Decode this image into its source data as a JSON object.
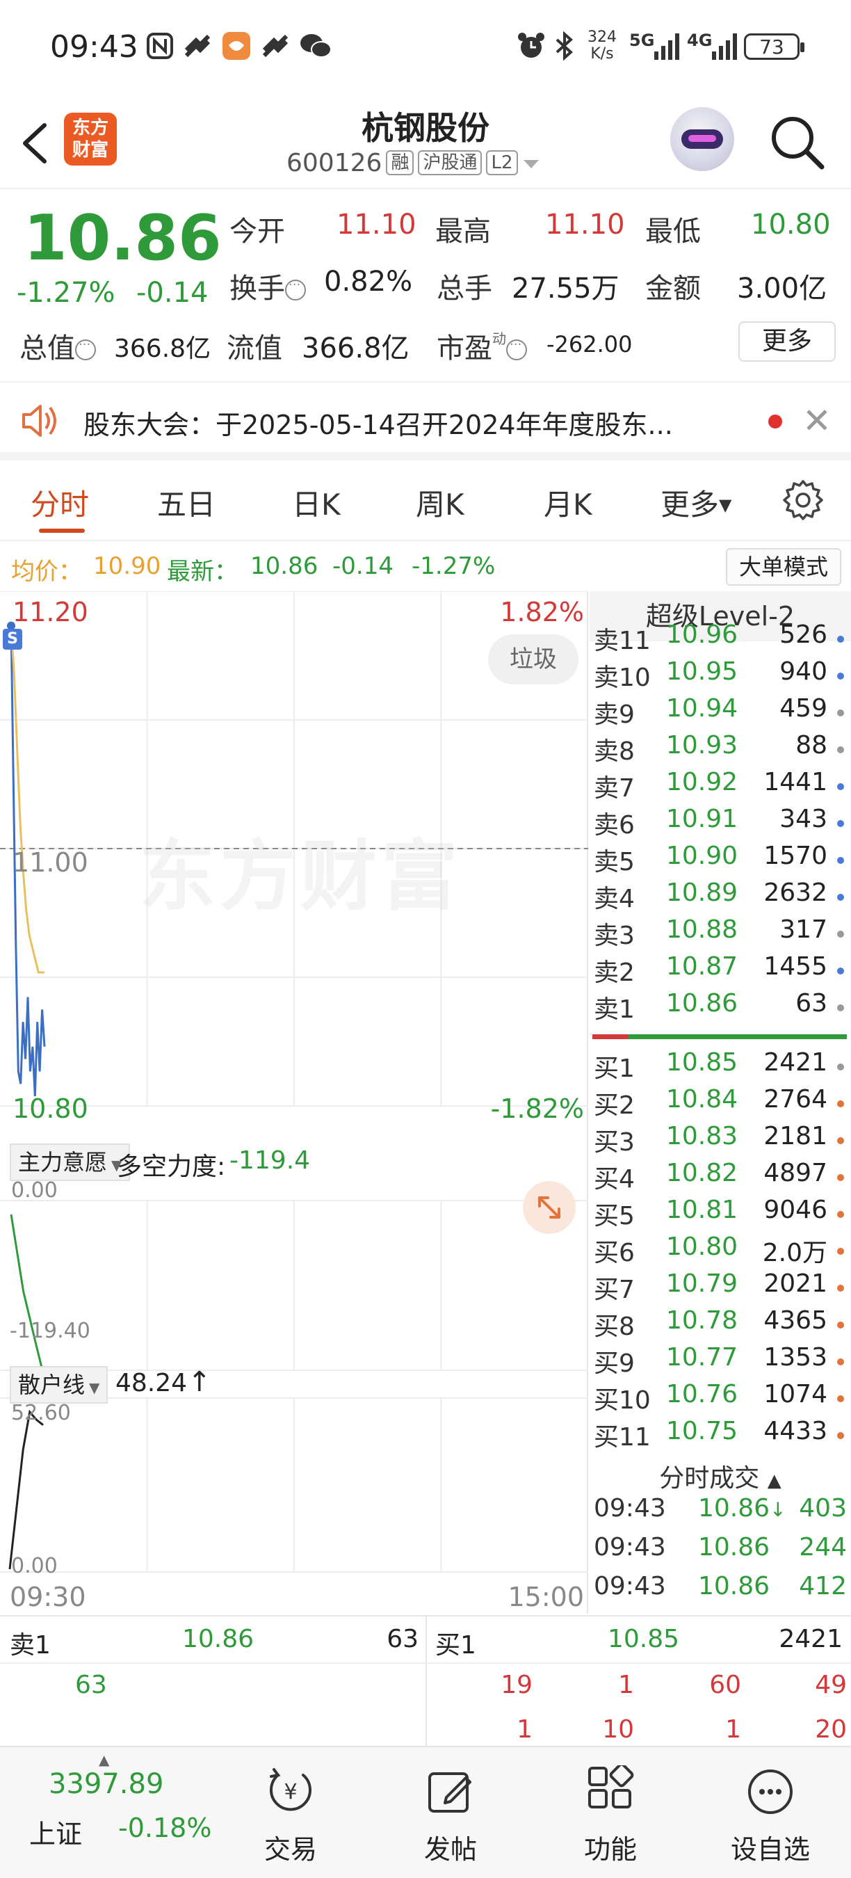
{
  "status_bar": {
    "time": "09:43",
    "net_speed_value": "324",
    "net_speed_unit": "K/s",
    "signal_5g": "5G",
    "signal_4g": "4G",
    "battery": "73"
  },
  "header": {
    "app_logo_line1": "东方",
    "app_logo_line2": "财富",
    "stock_name": "杭钢股份",
    "stock_code": "600126",
    "tags": [
      "融",
      "沪股通",
      "L2"
    ]
  },
  "quote": {
    "price": "10.86",
    "change_pct": "-1.27%",
    "change_amt": "-0.14",
    "open_label": "今开",
    "open": "11.10",
    "high_label": "最高",
    "high": "11.10",
    "low_label": "最低",
    "low": "10.80",
    "turnover_label": "换手",
    "turnover": "0.82%",
    "volume_label": "总手",
    "volume": "27.55万",
    "amount_label": "金额",
    "amount": "3.00亿",
    "mktcap_label": "总值",
    "mktcap": "366.8亿",
    "float_label": "流值",
    "float_cap": "366.8亿",
    "pe_label": "市盈",
    "pe_sup": "动",
    "pe": "-262.00",
    "more_label": "更多"
  },
  "notice": {
    "text": "股东大会：于2025-05-14召开2024年年度股东..."
  },
  "tabs": {
    "items": [
      "分时",
      "五日",
      "日K",
      "周K",
      "月K",
      "更多"
    ],
    "active_index": 0
  },
  "avg_bar": {
    "avg_label": "均价：",
    "avg_value": "10.90",
    "latest_label": "最新：",
    "latest_price": "10.86",
    "latest_change": "-0.14",
    "latest_pct": "-1.27%",
    "big_order_label": "大单模式"
  },
  "chart": {
    "top_price": "11.20",
    "top_pct": "1.82%",
    "mid_price": "11.00",
    "bottom_price": "10.80",
    "bottom_pct": "-1.82%",
    "start_time": "09:30",
    "end_time": "15:00",
    "watermark": "东方财富",
    "garbage_label": "垃圾",
    "s_marker": "S",
    "sub1_selector": "主力意愿",
    "sub1_label": "多空力度:",
    "sub1_value": "-119.4",
    "sub1_top": "0.00",
    "sub1_bottom": "-119.40",
    "sub2_selector": "散户线",
    "sub2_value": "48.24",
    "sub2_top": "52.60",
    "sub2_bottom": "0.00",
    "colors": {
      "price_line": "#3b6fc4",
      "avg_line": "#e8c060",
      "sub1_line": "#2f9a3a",
      "sub2_line": "#222222"
    }
  },
  "chart_data": {
    "type": "line",
    "x_range": [
      "09:30",
      "15:00"
    ],
    "ylim": [
      10.8,
      11.2
    ],
    "y_ref": 11.0,
    "series": [
      {
        "values": [
          11.18,
          11.05,
          10.92,
          10.82,
          10.81,
          10.86,
          10.83,
          10.88,
          10.82,
          10.84,
          10.8,
          10.86,
          10.82,
          10.87,
          10.84
        ]
      },
      {
        "values": [
          11.18,
          11.14,
          11.08,
          11.02,
          10.98,
          10.95,
          10.93,
          10.92,
          10.91,
          10.9,
          10.9,
          10.9
        ]
      }
    ],
    "sub_indicator_1": {
      "ylim": [
        -119.4,
        0.0
      ],
      "values": [
        0,
        -30,
        -60,
        -80,
        -100,
        -119.4
      ]
    },
    "sub_indicator_2": {
      "ylim": [
        0.0,
        52.6
      ],
      "values": [
        0,
        20,
        40,
        52.6,
        50,
        48.24
      ]
    }
  },
  "orderbook": {
    "title": "超级Level-2",
    "asks": [
      {
        "label": "卖11",
        "price": "10.96",
        "vol": "526",
        "dot": "#4a7ad8"
      },
      {
        "label": "卖10",
        "price": "10.95",
        "vol": "940",
        "dot": "#4a7ad8"
      },
      {
        "label": "卖9",
        "price": "10.94",
        "vol": "459",
        "dot": "#999999"
      },
      {
        "label": "卖8",
        "price": "10.93",
        "vol": "88",
        "dot": "#999999"
      },
      {
        "label": "卖7",
        "price": "10.92",
        "vol": "1441",
        "dot": "#4a7ad8"
      },
      {
        "label": "卖6",
        "price": "10.91",
        "vol": "343",
        "dot": "#4a7ad8"
      },
      {
        "label": "卖5",
        "price": "10.90",
        "vol": "1570",
        "dot": "#4a7ad8"
      },
      {
        "label": "卖4",
        "price": "10.89",
        "vol": "2632",
        "dot": "#4a7ad8"
      },
      {
        "label": "卖3",
        "price": "10.88",
        "vol": "317",
        "dot": "#999999"
      },
      {
        "label": "卖2",
        "price": "10.87",
        "vol": "1455",
        "dot": "#4a7ad8"
      },
      {
        "label": "卖1",
        "price": "10.86",
        "vol": "63",
        "dot": "#999999"
      }
    ],
    "bids": [
      {
        "label": "买1",
        "price": "10.85",
        "vol": "2421",
        "dot": "#999999"
      },
      {
        "label": "买2",
        "price": "10.84",
        "vol": "2764",
        "dot": "#e0743a"
      },
      {
        "label": "买3",
        "price": "10.83",
        "vol": "2181",
        "dot": "#e0743a"
      },
      {
        "label": "买4",
        "price": "10.82",
        "vol": "4897",
        "dot": "#e0743a"
      },
      {
        "label": "买5",
        "price": "10.81",
        "vol": "9046",
        "dot": "#e0743a"
      },
      {
        "label": "买6",
        "price": "10.80",
        "vol": "2.0万",
        "dot": "#e0743a"
      },
      {
        "label": "买7",
        "price": "10.79",
        "vol": "2021",
        "dot": "#e0743a"
      },
      {
        "label": "买8",
        "price": "10.78",
        "vol": "4365",
        "dot": "#e0743a"
      },
      {
        "label": "买9",
        "price": "10.77",
        "vol": "1353",
        "dot": "#e0743a"
      },
      {
        "label": "买10",
        "price": "10.76",
        "vol": "1074",
        "dot": "#e0743a"
      },
      {
        "label": "买11",
        "price": "10.75",
        "vol": "4433",
        "dot": "#e0743a"
      }
    ],
    "trades_title": "分时成交",
    "trades": [
      {
        "time": "09:43",
        "price": "10.86",
        "arrow": "↓",
        "vol": "403"
      },
      {
        "time": "09:43",
        "price": "10.86",
        "arrow": "",
        "vol": "244"
      },
      {
        "time": "09:43",
        "price": "10.86",
        "arrow": "",
        "vol": "412"
      }
    ]
  },
  "level1": {
    "ask_label": "卖1",
    "ask_price": "10.86",
    "ask_vol": "63",
    "bid_label": "买1",
    "bid_price": "10.85",
    "bid_vol": "2421",
    "ask_queue": [
      "63"
    ],
    "bid_queue_row1": [
      "19",
      "1",
      "60",
      "49"
    ],
    "bid_queue_row2": [
      "1",
      "10",
      "1",
      "20"
    ]
  },
  "bottom_nav": {
    "index_value": "3397.89",
    "index_name": "上证",
    "index_change": "-0.18%",
    "items": [
      "交易",
      "发帖",
      "功能",
      "设自选"
    ]
  }
}
